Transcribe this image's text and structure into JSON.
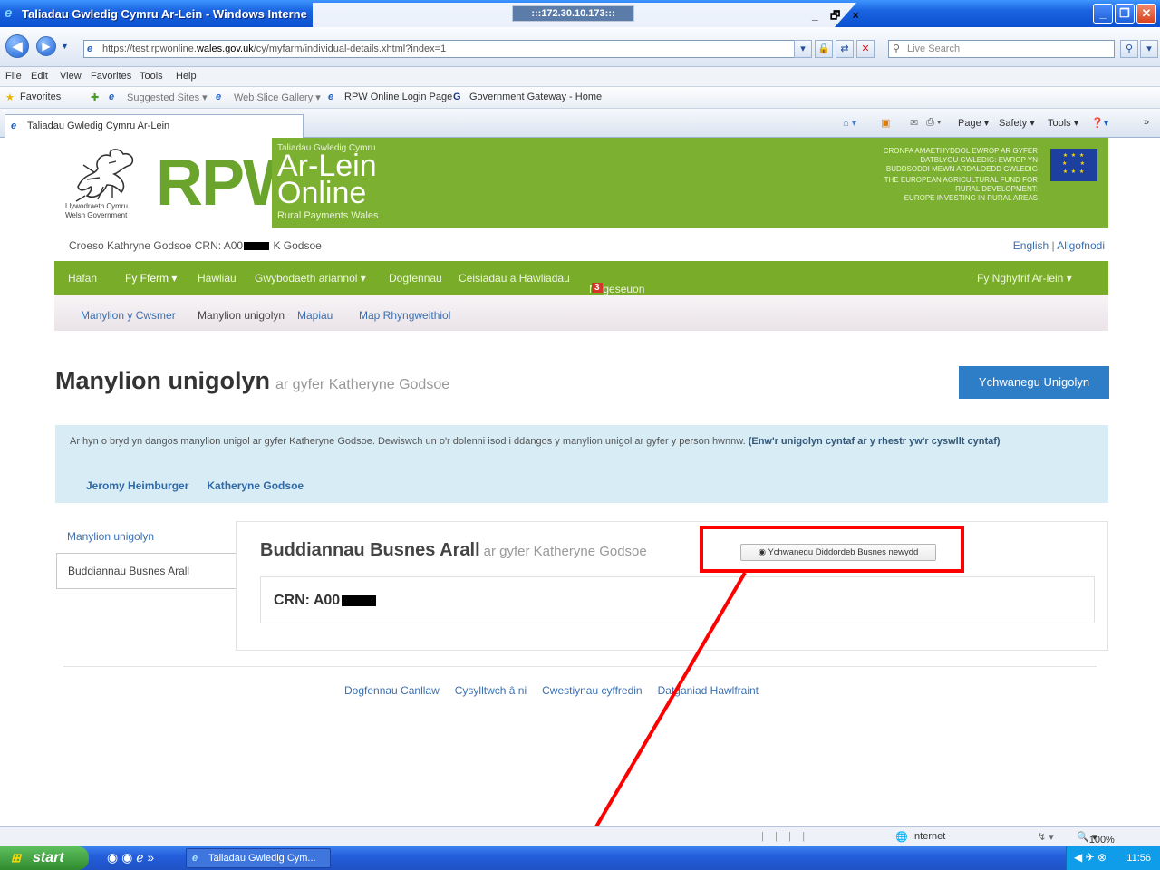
{
  "window": {
    "title": "Taliadau Gwledig Cymru Ar-Lein - Windows Interne",
    "remote_tag": ":::172.30.10.173:::",
    "mini_controls": "_ 🗗 ×"
  },
  "navbar": {
    "url_prefix": "https://test.rpwonline.",
    "url_host": "wales.gov.uk",
    "url_path": "/cy/myfarm/individual-details.xhtml?index=1",
    "search_placeholder": "Live Search"
  },
  "menubar": [
    "File",
    "Edit",
    "View",
    "Favorites",
    "Tools",
    "Help"
  ],
  "favorites_bar": {
    "favorites": "Favorites",
    "items": [
      "Suggested Sites ▾",
      "Web Slice Gallery ▾",
      "RPW Online Login Page",
      "Government Gateway - Home"
    ]
  },
  "tabbar": {
    "tab_title": "Taliadau Gwledig Cymru Ar-Lein",
    "commands": [
      "Page ▾",
      "Safety ▾",
      "Tools ▾"
    ]
  },
  "header": {
    "gov_name_cy": "Llywodraeth Cymru",
    "gov_name_en": "Welsh Government",
    "rpw": "RPW",
    "small_title": "Taliadau Gwledig Cymru",
    "ar_lein": "Ar-Lein",
    "online": "Online",
    "rural": "Rural Payments Wales",
    "eu_lines": [
      "CRONFA AMAETHYDDOL EWROP AR GYFER",
      "DATBLYGU GWLEDIG: EWROP YN",
      "BUDDSODDI MEWN ARDALOEDD GWLEDIG",
      "THE EUROPEAN AGRICULTURAL FUND FOR",
      "RURAL DEVELOPMENT:",
      "EUROPE INVESTING IN RURAL AREAS"
    ]
  },
  "welcome": {
    "prefix": "Croeso Kathryne Godsoe CRN: A00",
    "suffix": " K Godsoe",
    "lang_english": "English",
    "lang_sep": " | ",
    "logout": "Allgofnodi"
  },
  "mainnav": {
    "items": [
      "Hafan",
      "Fy Fferm ▾",
      "Hawliau",
      "Gwybodaeth ariannol ▾",
      "Dogfennau",
      "Ceisiadau a Hawliadau",
      "Negeseuon"
    ],
    "messages_count": "3",
    "right": "Fy Nghyfrif Ar-lein ▾"
  },
  "subnav": [
    "Manylion y Cwsmer",
    "Manylion unigolyn",
    "Mapiau",
    "Map Rhyngweithiol"
  ],
  "page": {
    "title": "Manylion unigolyn",
    "subtitle": "ar gyfer Katheryne Godsoe",
    "add_button": "Ychwanegu Unigolyn",
    "info_text": "Ar hyn o bryd yn dangos manylion unigol ar gyfer Katheryne Godsoe. Dewiswch un o'r dolenni isod i ddangos y manylion unigol ar gyfer y person hwnnw.",
    "info_bold": "(Enw'r unigolyn cyntaf ar y rhestr yw'r cyswllt cyntaf)",
    "people": [
      "Jeromy Heimburger",
      "Katheryne Godsoe"
    ]
  },
  "sidemenu": [
    "Manylion unigolyn",
    "Buddiannau Busnes Arall"
  ],
  "panel": {
    "title": "Buddiannau Busnes Arall",
    "subtitle": "ar gyfer Katheryne Godsoe",
    "add_interest": "Ychwanegu Diddordeb Busnes newydd",
    "crn_label": "CRN: A00"
  },
  "footer": [
    "Dogfennau Canllaw",
    "Cysylltwch â ni",
    "Cwestiynau cyffredin",
    "Datganiad Hawlfraint"
  ],
  "statusbar": {
    "zone": "Internet",
    "zoom": "100%"
  },
  "taskbar": {
    "start": "start",
    "task": "Taliadau Gwledig Cym...",
    "clock": "11:56"
  },
  "colors": {
    "rpw_green": "#7cb030",
    "nav_green": "#79ac29",
    "link_blue": "#3a6fb0",
    "button_blue": "#2d7ec6",
    "annotation_red": "#ff0000"
  }
}
